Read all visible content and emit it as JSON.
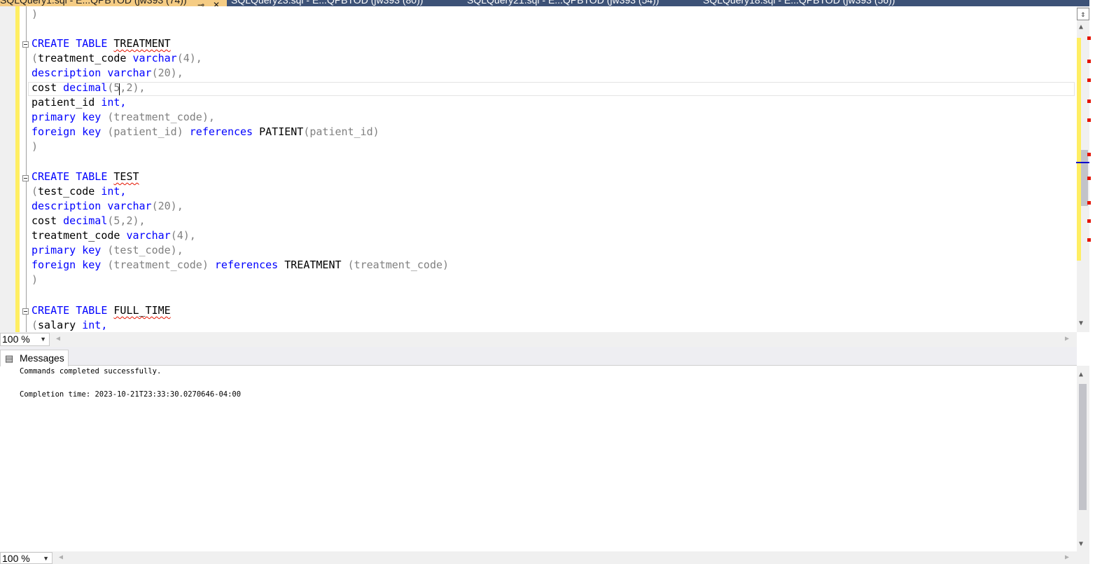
{
  "tabs": [
    {
      "label": "SQLQuery1.sql - E...QPBTOD (jw393 (74))",
      "active": true,
      "pin": "⊸",
      "close": "✕"
    },
    {
      "label": "SQLQuery23.sql - E...QPBTOD (jw393 (80))",
      "active": false
    },
    {
      "label": "SQLQuery21.sql - E...QPBTOD (jw393 (54))",
      "active": false
    },
    {
      "label": "SQLQuery18.sql - E...QPBTOD (jw393 (56))",
      "active": false
    }
  ],
  "code": {
    "l0": ")",
    "t1_create": "CREATE",
    "t1_table": "TABLE",
    "t1_name": "TREATMENT",
    "t1_c1_open": "(",
    "t1_c1_name": "treatment_code",
    "t1_c1_type": "varchar",
    "t1_c1_args": "(4),",
    "t1_c2_name": "description",
    "t1_c2_type": "varchar",
    "t1_c2_args": "(20),",
    "t1_c3_name": "cost",
    "t1_c3_type": "decimal",
    "t1_c3_args": "(5,2),",
    "t1_c4_name": "patient_id",
    "t1_c4_type": "int,",
    "t1_pk_kw": "primary key",
    "t1_pk_args": "(treatment_code),",
    "t1_fk_kw": "foreign key",
    "t1_fk_args": "(patient_id)",
    "t1_fk_ref": "references",
    "t1_fk_target": "PATIENT",
    "t1_fk_target_args": "(patient_id)",
    "t1_close": ")",
    "t2_create": "CREATE",
    "t2_table": "TABLE",
    "t2_name": "TEST",
    "t2_c1_open": "(",
    "t2_c1_name": "test_code",
    "t2_c1_type": "int,",
    "t2_c2_name": "description",
    "t2_c2_type": "varchar",
    "t2_c2_args": "(20),",
    "t2_c3_name": "cost",
    "t2_c3_type": "decimal",
    "t2_c3_args": "(5,2),",
    "t2_c4_name": "treatment_code",
    "t2_c4_type": "varchar",
    "t2_c4_args": "(4),",
    "t2_pk_kw": "primary key",
    "t2_pk_args": "(test_code),",
    "t2_fk_kw": "foreign key",
    "t2_fk_args": "(treatment_code)",
    "t2_fk_ref": "references",
    "t2_fk_target": "TREATMENT",
    "t2_fk_target_args": "(treatment_code)",
    "t2_close": ")",
    "t3_create": "CREATE",
    "t3_table": "TABLE",
    "t3_name": "FULL_TIME",
    "t3_c1_open": "(",
    "t3_c1_name": "salary",
    "t3_c1_type": "int,"
  },
  "editor_zoom": "100 %",
  "results": {
    "tab_label": "Messages",
    "tab_icon": "messages-icon",
    "line1": "Commands completed successfully.",
    "line2": "Completion time: 2023-10-21T23:33:30.0270646-04:00",
    "zoom": "100 %"
  },
  "colors": {
    "keyword": "#0000ff",
    "punctuation": "#808080",
    "active_tab": "#f5cc84",
    "tab_strip": "#3d5277",
    "change_bar": "#ffee62",
    "error_mark": "#e51400"
  }
}
